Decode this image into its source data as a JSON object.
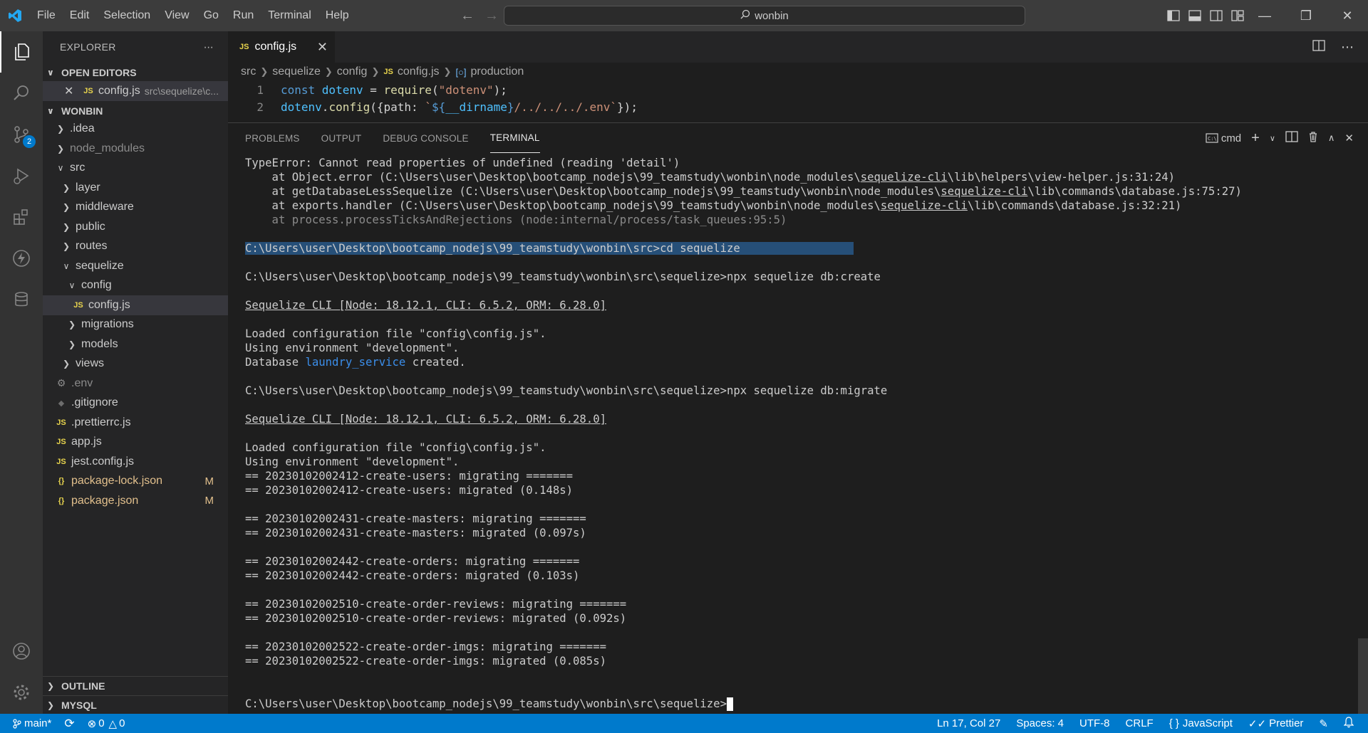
{
  "menu": [
    "File",
    "Edit",
    "Selection",
    "View",
    "Go",
    "Run",
    "Terminal",
    "Help"
  ],
  "command_center": "wonbin",
  "sidebar": {
    "title": "EXPLORER",
    "open_editors_label": "OPEN EDITORS",
    "open_editor": {
      "name": "config.js",
      "path": "src\\sequelize\\c..."
    },
    "project_label": "WONBIN",
    "tree": [
      {
        "name": ".idea",
        "type": "folder",
        "expanded": false,
        "depth": 0
      },
      {
        "name": "node_modules",
        "type": "folder",
        "expanded": false,
        "depth": 0,
        "dim": true
      },
      {
        "name": "src",
        "type": "folder",
        "expanded": true,
        "depth": 0
      },
      {
        "name": "layer",
        "type": "folder",
        "expanded": false,
        "depth": 1
      },
      {
        "name": "middleware",
        "type": "folder",
        "expanded": false,
        "depth": 1
      },
      {
        "name": "public",
        "type": "folder",
        "expanded": false,
        "depth": 1
      },
      {
        "name": "routes",
        "type": "folder",
        "expanded": false,
        "depth": 1
      },
      {
        "name": "sequelize",
        "type": "folder",
        "expanded": true,
        "depth": 1
      },
      {
        "name": "config",
        "type": "folder",
        "expanded": true,
        "depth": 2
      },
      {
        "name": "config.js",
        "type": "js",
        "depth": 3,
        "selected": true
      },
      {
        "name": "migrations",
        "type": "folder",
        "expanded": false,
        "depth": 2
      },
      {
        "name": "models",
        "type": "folder",
        "expanded": false,
        "depth": 2
      },
      {
        "name": "views",
        "type": "folder",
        "expanded": false,
        "depth": 1
      },
      {
        "name": ".env",
        "type": "env",
        "depth": 0,
        "dim": true
      },
      {
        "name": ".gitignore",
        "type": "git",
        "depth": 0
      },
      {
        "name": ".prettierrc.js",
        "type": "js",
        "depth": 0
      },
      {
        "name": "app.js",
        "type": "js",
        "depth": 0
      },
      {
        "name": "jest.config.js",
        "type": "js",
        "depth": 0
      },
      {
        "name": "package-lock.json",
        "type": "json",
        "depth": 0,
        "modified": "M"
      },
      {
        "name": "package.json",
        "type": "json",
        "depth": 0,
        "modified": "M"
      }
    ],
    "outline_label": "OUTLINE",
    "mysql_label": "MYSQL"
  },
  "scm_badge": "2",
  "editor": {
    "tab_name": "config.js",
    "breadcrumb": [
      "src",
      "sequelize",
      "config",
      "config.js",
      "production"
    ],
    "code_lines": [
      {
        "num": "1",
        "text": "const dotenv = require(\"dotenv\");"
      },
      {
        "num": "2",
        "text": "dotenv.config({path: `${__dirname}/../../../.env`});"
      }
    ]
  },
  "panel": {
    "tabs": [
      "PROBLEMS",
      "OUTPUT",
      "DEBUG CONSOLE",
      "TERMINAL"
    ],
    "active_tab": "TERMINAL",
    "shell_label": "cmd"
  },
  "terminal": {
    "error_line": "TypeError: Cannot read properties of undefined (reading 'detail')",
    "stack": [
      [
        "    at Object.error (C:\\Users\\user\\Desktop\\bootcamp_nodejs\\99_teamstudy\\wonbin\\node_modules\\",
        "sequelize-cli",
        "\\lib\\helpers\\view-helper.js:31:24)"
      ],
      [
        "    at getDatabaseLessSequelize (C:\\Users\\user\\Desktop\\bootcamp_nodejs\\99_teamstudy\\wonbin\\node_modules\\",
        "sequelize-cli",
        "\\lib\\commands\\database.js:75:27)"
      ],
      [
        "    at exports.handler (C:\\Users\\user\\Desktop\\bootcamp_nodejs\\99_teamstudy\\wonbin\\node_modules\\",
        "sequelize-cli",
        "\\lib\\commands\\database.js:32:21)"
      ]
    ],
    "stack_gray": "    at process.processTicksAndRejections (node:internal/process/task_queues:95:5)",
    "cmd1": "C:\\Users\\user\\Desktop\\bootcamp_nodejs\\99_teamstudy\\wonbin\\src>cd sequelize",
    "cmd2": "C:\\Users\\user\\Desktop\\bootcamp_nodejs\\99_teamstudy\\wonbin\\src\\sequelize>npx sequelize db:create",
    "cli_banner": "Sequelize CLI [Node: 18.12.1, CLI: 6.5.2, ORM: 6.28.0]",
    "loaded": "Loaded configuration file \"config\\config.js\".",
    "env": "Using environment \"development\".",
    "db_prefix": "Database ",
    "db_name": "laundry_service",
    "db_suffix": " created.",
    "cmd3": "C:\\Users\\user\\Desktop\\bootcamp_nodejs\\99_teamstudy\\wonbin\\src\\sequelize>npx sequelize db:migrate",
    "migrations": [
      [
        "== 20230102002412-create-users: migrating =======",
        "== 20230102002412-create-users: migrated (0.148s)"
      ],
      [
        "== 20230102002431-create-masters: migrating =======",
        "== 20230102002431-create-masters: migrated (0.097s)"
      ],
      [
        "== 20230102002442-create-orders: migrating =======",
        "== 20230102002442-create-orders: migrated (0.103s)"
      ],
      [
        "== 20230102002510-create-order-reviews: migrating =======",
        "== 20230102002510-create-order-reviews: migrated (0.092s)"
      ],
      [
        "== 20230102002522-create-order-imgs: migrating =======",
        "== 20230102002522-create-order-imgs: migrated (0.085s)"
      ]
    ],
    "prompt": "C:\\Users\\user\\Desktop\\bootcamp_nodejs\\99_teamstudy\\wonbin\\src\\sequelize>"
  },
  "status": {
    "branch": "main*",
    "errors": "0",
    "warnings": "0",
    "position": "Ln 17, Col 27",
    "spaces": "Spaces: 4",
    "encoding": "UTF-8",
    "eol": "CRLF",
    "language": "JavaScript",
    "formatter": "Prettier"
  },
  "colors": {
    "accent": "#007acc",
    "titlebar": "#3c3c3c",
    "sidebar": "#252526",
    "editor": "#1e1e1e"
  }
}
